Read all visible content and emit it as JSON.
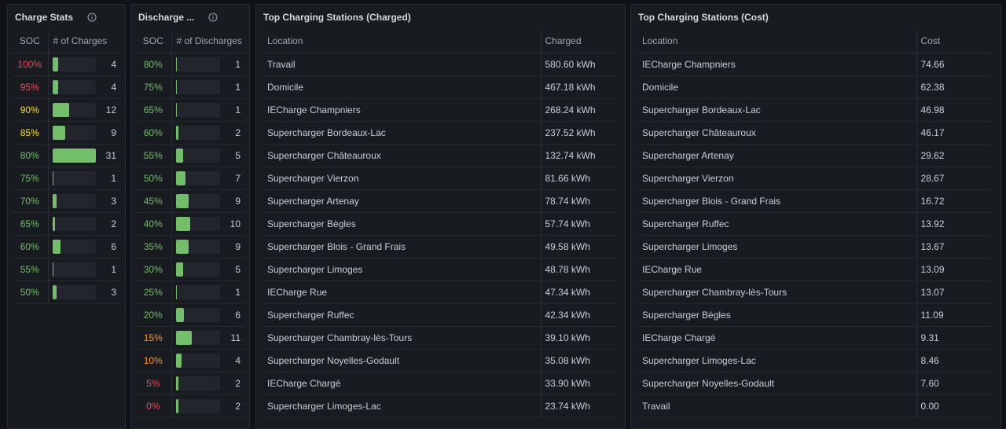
{
  "charge_stats": {
    "title": "Charge Stats",
    "col_soc": "SOC",
    "col_count": "# of Charges",
    "max": 31,
    "rows": [
      {
        "soc": "100%",
        "count": "4",
        "value": 4,
        "color": "#f2495c"
      },
      {
        "soc": "95%",
        "count": "4",
        "value": 4,
        "color": "#f2495c"
      },
      {
        "soc": "90%",
        "count": "12",
        "value": 12,
        "color": "#fade2a"
      },
      {
        "soc": "85%",
        "count": "9",
        "value": 9,
        "color": "#fade2a"
      },
      {
        "soc": "80%",
        "count": "31",
        "value": 31,
        "color": "#73bf69"
      },
      {
        "soc": "75%",
        "count": "1",
        "value": 1,
        "color": "#73bf69"
      },
      {
        "soc": "70%",
        "count": "3",
        "value": 3,
        "color": "#73bf69"
      },
      {
        "soc": "65%",
        "count": "2",
        "value": 2,
        "color": "#73bf69"
      },
      {
        "soc": "60%",
        "count": "6",
        "value": 6,
        "color": "#73bf69"
      },
      {
        "soc": "55%",
        "count": "1",
        "value": 1,
        "color": "#73bf69"
      },
      {
        "soc": "50%",
        "count": "3",
        "value": 3,
        "color": "#73bf69"
      }
    ]
  },
  "discharge_stats": {
    "title": "Discharge ...",
    "col_soc": "SOC",
    "col_count": "# of Discharges",
    "max": 31,
    "rows": [
      {
        "soc": "80%",
        "count": "1",
        "value": 1,
        "color": "#73bf69"
      },
      {
        "soc": "75%",
        "count": "1",
        "value": 1,
        "color": "#73bf69"
      },
      {
        "soc": "65%",
        "count": "1",
        "value": 1,
        "color": "#73bf69"
      },
      {
        "soc": "60%",
        "count": "2",
        "value": 2,
        "color": "#73bf69"
      },
      {
        "soc": "55%",
        "count": "5",
        "value": 5,
        "color": "#73bf69"
      },
      {
        "soc": "50%",
        "count": "7",
        "value": 7,
        "color": "#73bf69"
      },
      {
        "soc": "45%",
        "count": "9",
        "value": 9,
        "color": "#73bf69"
      },
      {
        "soc": "40%",
        "count": "10",
        "value": 10,
        "color": "#73bf69"
      },
      {
        "soc": "35%",
        "count": "9",
        "value": 9,
        "color": "#73bf69"
      },
      {
        "soc": "30%",
        "count": "5",
        "value": 5,
        "color": "#73bf69"
      },
      {
        "soc": "25%",
        "count": "1",
        "value": 1,
        "color": "#73bf69"
      },
      {
        "soc": "20%",
        "count": "6",
        "value": 6,
        "color": "#73bf69"
      },
      {
        "soc": "15%",
        "count": "11",
        "value": 11,
        "color": "#ff9830"
      },
      {
        "soc": "10%",
        "count": "4",
        "value": 4,
        "color": "#ff9830"
      },
      {
        "soc": "5%",
        "count": "2",
        "value": 2,
        "color": "#f2495c"
      },
      {
        "soc": "0%",
        "count": "2",
        "value": 2,
        "color": "#f2495c"
      }
    ]
  },
  "top_charged": {
    "title": "Top Charging Stations (Charged)",
    "col_location": "Location",
    "col_value": "Charged",
    "rows": [
      {
        "location": "Travail",
        "value": "580.60 kWh"
      },
      {
        "location": "Domicile",
        "value": "467.18 kWh"
      },
      {
        "location": "IECharge Champniers",
        "value": "268.24 kWh"
      },
      {
        "location": "Supercharger Bordeaux-Lac",
        "value": "237.52 kWh"
      },
      {
        "location": "Supercharger Châteauroux",
        "value": "132.74 kWh"
      },
      {
        "location": "Supercharger Vierzon",
        "value": "81.66 kWh"
      },
      {
        "location": "Supercharger Artenay",
        "value": "78.74 kWh"
      },
      {
        "location": "Supercharger Bègles",
        "value": "57.74 kWh"
      },
      {
        "location": "Supercharger Blois - Grand Frais",
        "value": "49.58 kWh"
      },
      {
        "location": "Supercharger Limoges",
        "value": "48.78 kWh"
      },
      {
        "location": "IECharge Rue",
        "value": "47.34 kWh"
      },
      {
        "location": "Supercharger Ruffec",
        "value": "42.34 kWh"
      },
      {
        "location": "Supercharger Chambray-lès-Tours",
        "value": "39.10 kWh"
      },
      {
        "location": "Supercharger Noyelles-Godault",
        "value": "35.08 kWh"
      },
      {
        "location": "IECharge Chargé",
        "value": "33.90 kWh"
      },
      {
        "location": "Supercharger Limoges-Lac",
        "value": "23.74 kWh"
      }
    ]
  },
  "top_cost": {
    "title": "Top Charging Stations (Cost)",
    "col_location": "Location",
    "col_value": "Cost",
    "rows": [
      {
        "location": "IECharge Champniers",
        "value": "74.66"
      },
      {
        "location": "Domicile",
        "value": "62.38"
      },
      {
        "location": "Supercharger Bordeaux-Lac",
        "value": "46.98"
      },
      {
        "location": "Supercharger Châteauroux",
        "value": "46.17"
      },
      {
        "location": "Supercharger Artenay",
        "value": "29.62"
      },
      {
        "location": "Supercharger Vierzon",
        "value": "28.67"
      },
      {
        "location": "Supercharger Blois - Grand Frais",
        "value": "16.72"
      },
      {
        "location": "Supercharger Ruffec",
        "value": "13.92"
      },
      {
        "location": "Supercharger Limoges",
        "value": "13.67"
      },
      {
        "location": "IECharge Rue",
        "value": "13.09"
      },
      {
        "location": "Supercharger Chambray-lès-Tours",
        "value": "13.07"
      },
      {
        "location": "Supercharger Bègles",
        "value": "11.09"
      },
      {
        "location": "IECharge Chargé",
        "value": "9.31"
      },
      {
        "location": "Supercharger Limoges-Lac",
        "value": "8.46"
      },
      {
        "location": "Supercharger Noyelles-Godault",
        "value": "7.60"
      },
      {
        "location": "Travail",
        "value": "0.00"
      }
    ]
  }
}
